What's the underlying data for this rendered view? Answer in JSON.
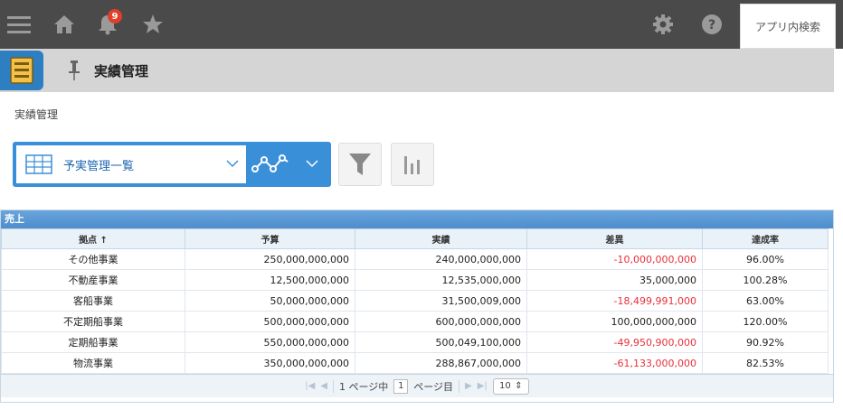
{
  "topbar": {
    "notification_count": "9",
    "search_label": "アプリ内検索"
  },
  "app": {
    "title": "実績管理",
    "breadcrumb": "実績管理"
  },
  "view": {
    "name": "予実管理一覧"
  },
  "table": {
    "caption": "売上",
    "headers": [
      "拠点 ↑",
      "予算",
      "実績",
      "差異",
      "達成率"
    ],
    "rows": [
      [
        "その他事業",
        "250,000,000,000",
        "240,000,000,000",
        "-10,000,000,000",
        "96.00%"
      ],
      [
        "不動産事業",
        "12,500,000,000",
        "12,535,000,000",
        "35,000,000",
        "100.28%"
      ],
      [
        "客船事業",
        "50,000,000,000",
        "31,500,009,000",
        "-18,499,991,000",
        "63.00%"
      ],
      [
        "不定期船事業",
        "500,000,000,000",
        "600,000,000,000",
        "100,000,000,000",
        "120.00%"
      ],
      [
        "定期船事業",
        "550,000,000,000",
        "500,049,100,000",
        "-49,950,900,000",
        "90.92%"
      ],
      [
        "物流事業",
        "350,000,000,000",
        "288,867,000,000",
        "-61,133,000,000",
        "82.53%"
      ]
    ]
  },
  "pager": {
    "prefix": "1 ページ中",
    "page": "1",
    "suffix": "ページ目",
    "page_size": "10"
  },
  "colors": {
    "topbar": "#4a4a4a",
    "accent": "#3a8fd9",
    "negative": "#e8313b"
  }
}
